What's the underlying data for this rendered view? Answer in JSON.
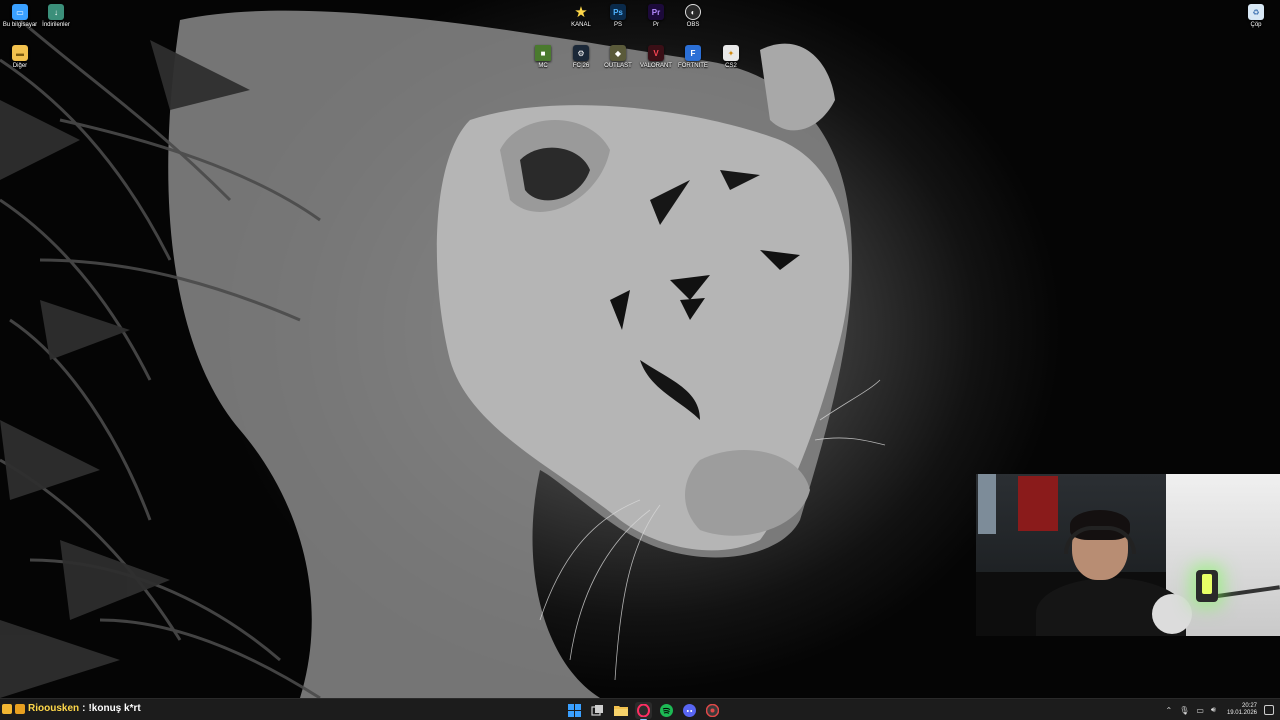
{
  "desktop": {
    "left_icons": [
      {
        "label": "Bu bilgisayar",
        "icon": "computer-icon"
      },
      {
        "label": "İndirilenler",
        "icon": "downloads-icon"
      },
      {
        "label": "Diğer",
        "icon": "folder-icon"
      }
    ],
    "top_row": [
      {
        "label": "KANAL",
        "icon": "star-icon"
      },
      {
        "label": "PS",
        "icon": "photoshop-icon"
      },
      {
        "label": "Pr",
        "icon": "premiere-icon"
      },
      {
        "label": "OBS",
        "icon": "obs-icon"
      }
    ],
    "game_row": [
      {
        "label": "MC",
        "icon": "minecraft-icon"
      },
      {
        "label": "FC 26",
        "icon": "steam-icon"
      },
      {
        "label": "OUTLAST",
        "icon": "outlast-icon"
      },
      {
        "label": "VALORANT",
        "icon": "valorant-icon"
      },
      {
        "label": "FORTNITE",
        "icon": "fortnite-icon"
      },
      {
        "label": "CS2",
        "icon": "cs2-icon"
      }
    ],
    "recycle_bin": {
      "label": "Çöp",
      "icon": "recycle-bin-icon"
    }
  },
  "chat_overlay": {
    "username": "Rioousken",
    "separator": ":",
    "message": "!konuş k*rt"
  },
  "taskbar": {
    "apps": [
      {
        "name": "start",
        "icon": "windows-start-icon",
        "color": "#3aa0ff"
      },
      {
        "name": "task-view",
        "icon": "task-view-icon",
        "color": "#cfcfcf"
      },
      {
        "name": "file-explorer",
        "icon": "folder-icon",
        "color": "#f2c14e"
      },
      {
        "name": "opera-gx",
        "icon": "opera-gx-icon",
        "color": "#ff2e63"
      },
      {
        "name": "spotify",
        "icon": "spotify-icon",
        "color": "#1db954"
      },
      {
        "name": "discord",
        "icon": "discord-icon",
        "color": "#5865f2"
      },
      {
        "name": "steam-red",
        "icon": "game-launcher-icon",
        "color": "#e04848"
      }
    ],
    "clock": {
      "time": "20:27",
      "date": "19.01.2026"
    }
  }
}
